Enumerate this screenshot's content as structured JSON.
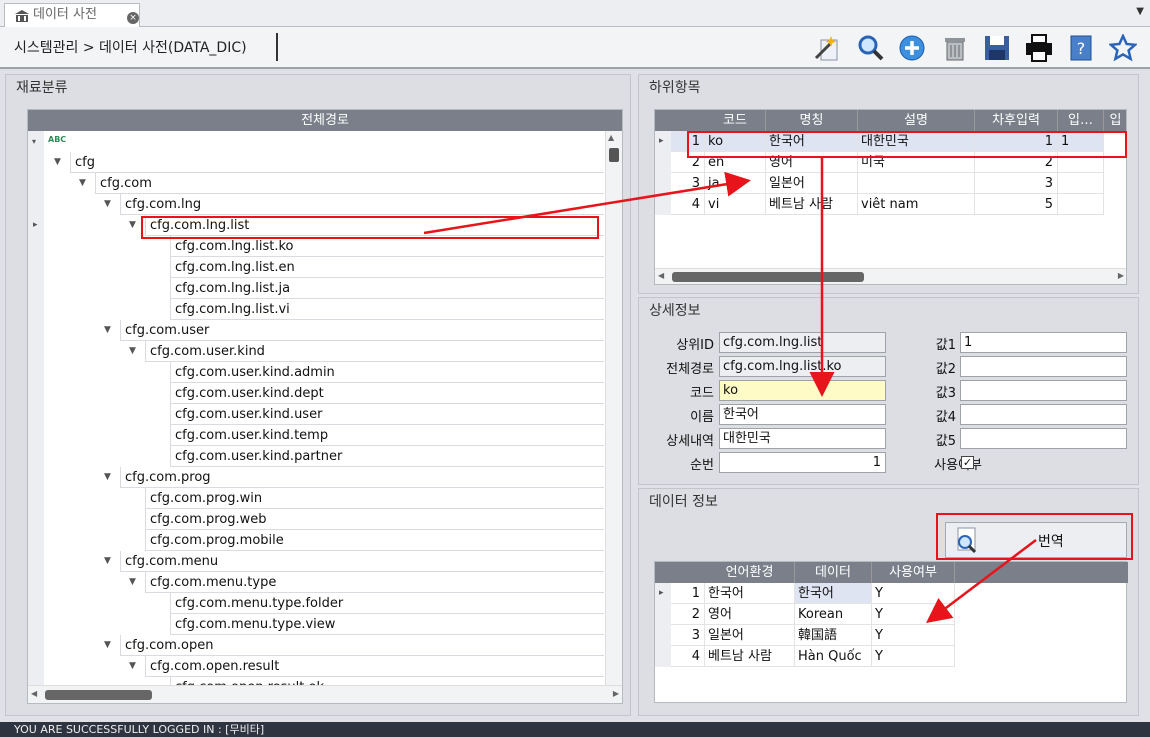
{
  "tab": {
    "title": "데이터 사전",
    "close": "×"
  },
  "breadcrumb": "시스템관리 > 데이터 사전(DATA_DIC)",
  "toolbar_icons": [
    "magic-wand-icon",
    "search-icon",
    "add-icon",
    "trash-icon",
    "save-icon",
    "print-icon",
    "help-icon",
    "star-icon"
  ],
  "left": {
    "title": "재료분류",
    "column": "전체경로",
    "root": "ABC",
    "tree": [
      {
        "label": "cfg",
        "level": 0,
        "exp": true
      },
      {
        "label": "cfg.com",
        "level": 1,
        "exp": true
      },
      {
        "label": "cfg.com.lng",
        "level": 2,
        "exp": true
      },
      {
        "label": "cfg.com.lng.list",
        "level": 3,
        "exp": true
      },
      {
        "label": "cfg.com.lng.list.ko",
        "level": 4
      },
      {
        "label": "cfg.com.lng.list.en",
        "level": 4
      },
      {
        "label": "cfg.com.lng.list.ja",
        "level": 4
      },
      {
        "label": "cfg.com.lng.list.vi",
        "level": 4
      },
      {
        "label": "cfg.com.user",
        "level": 2,
        "exp": true
      },
      {
        "label": "cfg.com.user.kind",
        "level": 3,
        "exp": true
      },
      {
        "label": "cfg.com.user.kind.admin",
        "level": 4
      },
      {
        "label": "cfg.com.user.kind.dept",
        "level": 4
      },
      {
        "label": "cfg.com.user.kind.user",
        "level": 4
      },
      {
        "label": "cfg.com.user.kind.temp",
        "level": 4
      },
      {
        "label": "cfg.com.user.kind.partner",
        "level": 4
      },
      {
        "label": "cfg.com.prog",
        "level": 2,
        "exp": true
      },
      {
        "label": "cfg.com.prog.win",
        "level": 3
      },
      {
        "label": "cfg.com.prog.web",
        "level": 3
      },
      {
        "label": "cfg.com.prog.mobile",
        "level": 3
      },
      {
        "label": "cfg.com.menu",
        "level": 2,
        "exp": true
      },
      {
        "label": "cfg.com.menu.type",
        "level": 3,
        "exp": true
      },
      {
        "label": "cfg.com.menu.type.folder",
        "level": 4
      },
      {
        "label": "cfg.com.menu.type.view",
        "level": 4
      },
      {
        "label": "cfg.com.open",
        "level": 2,
        "exp": true
      },
      {
        "label": "cfg.com.open.result",
        "level": 3,
        "exp": true
      },
      {
        "label": "cfg.com.open.result.ok",
        "level": 4
      }
    ]
  },
  "sub": {
    "title": "하위항목",
    "columns": [
      "코드",
      "명칭",
      "설명",
      "차후입력",
      "입…",
      "입"
    ],
    "rows": [
      {
        "n": "1",
        "code": "ko",
        "name": "한국어",
        "desc": "대한민국",
        "val": "1",
        "x": "1"
      },
      {
        "n": "2",
        "code": "en",
        "name": "영어",
        "desc": "미국",
        "val": "2",
        "x": ""
      },
      {
        "n": "3",
        "code": "ja",
        "name": "일본어",
        "desc": "",
        "val": "3",
        "x": ""
      },
      {
        "n": "4",
        "code": "vi",
        "name": "베트남 사람",
        "desc": "viêt nam",
        "val": "5",
        "x": ""
      }
    ]
  },
  "detail": {
    "title": "상세정보",
    "fields": [
      {
        "label": "상위ID",
        "value": "cfg.com.lng.list"
      },
      {
        "label": "전체경로",
        "value": "cfg.com.lng.list.ko"
      },
      {
        "label": "코드",
        "value": "ko"
      },
      {
        "label": "이름",
        "value": "한국어"
      },
      {
        "label": "상세내역",
        "value": "대한민국"
      },
      {
        "label": "순번",
        "value": "1"
      }
    ],
    "vals": [
      {
        "label": "값1",
        "value": "1"
      },
      {
        "label": "값2",
        "value": ""
      },
      {
        "label": "값3",
        "value": ""
      },
      {
        "label": "값4",
        "value": ""
      },
      {
        "label": "값5",
        "value": ""
      }
    ],
    "use_label": "사용여부",
    "use_checked": true
  },
  "data": {
    "title": "데이터 정보",
    "translate": "번역",
    "columns": [
      "언어환경",
      "데이터",
      "사용여부"
    ],
    "rows": [
      {
        "n": "1",
        "lang": "한국어",
        "data": "한국어",
        "use": "Y"
      },
      {
        "n": "2",
        "lang": "영어",
        "data": "Korean",
        "use": "Y"
      },
      {
        "n": "3",
        "lang": "일본어",
        "data": "韓国語",
        "use": "Y"
      },
      {
        "n": "4",
        "lang": "베트남 사람",
        "data": "Hàn Quốc",
        "use": "Y"
      }
    ]
  },
  "status": "YOU ARE SUCCESSFULLY LOGGED IN : [무비타]",
  "colors": {
    "header": "#7a7f8a",
    "highlight": "#e8141b",
    "selected": "#dfe4f2"
  }
}
